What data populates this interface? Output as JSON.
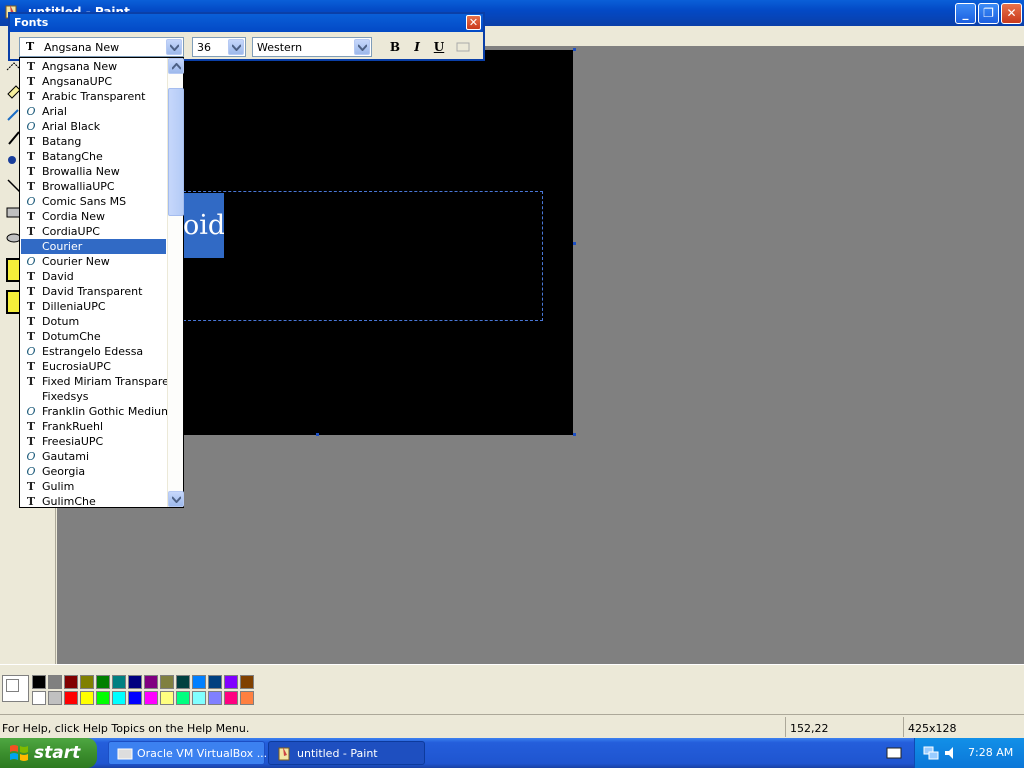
{
  "window": {
    "title": "untitled - Paint"
  },
  "fonts_toolbar": {
    "title": "Fonts",
    "font_name": "Angsana New",
    "font_size": "36",
    "script": "Western",
    "bold_label": "B",
    "italic_label": "I",
    "underline_label": "U"
  },
  "font_list": {
    "items": [
      {
        "name": "Angsana New",
        "icon": "truetype-icon"
      },
      {
        "name": "AngsanaUPC",
        "icon": "truetype-icon"
      },
      {
        "name": "Arabic Transparent",
        "icon": "truetype-icon"
      },
      {
        "name": "Arial",
        "icon": "opentype-icon"
      },
      {
        "name": "Arial Black",
        "icon": "opentype-icon"
      },
      {
        "name": "Batang",
        "icon": "truetype-icon"
      },
      {
        "name": "BatangChe",
        "icon": "truetype-icon"
      },
      {
        "name": "Browallia New",
        "icon": "truetype-icon"
      },
      {
        "name": "BrowalliaUPC",
        "icon": "truetype-icon"
      },
      {
        "name": "Comic Sans MS",
        "icon": "opentype-icon"
      },
      {
        "name": "Cordia New",
        "icon": "truetype-icon"
      },
      {
        "name": "CordiaUPC",
        "icon": "truetype-icon"
      },
      {
        "name": "Courier",
        "icon": "none"
      },
      {
        "name": "Courier New",
        "icon": "opentype-icon"
      },
      {
        "name": "David",
        "icon": "truetype-icon"
      },
      {
        "name": "David Transparent",
        "icon": "truetype-icon"
      },
      {
        "name": "DilleniaUPC",
        "icon": "truetype-icon"
      },
      {
        "name": "Dotum",
        "icon": "truetype-icon"
      },
      {
        "name": "DotumChe",
        "icon": "truetype-icon"
      },
      {
        "name": "Estrangelo Edessa",
        "icon": "opentype-icon"
      },
      {
        "name": "EucrosiaUPC",
        "icon": "truetype-icon"
      },
      {
        "name": "Fixed Miriam Transparent",
        "icon": "truetype-icon"
      },
      {
        "name": "Fixedsys",
        "icon": "none"
      },
      {
        "name": "Franklin Gothic Medium",
        "icon": "opentype-icon"
      },
      {
        "name": "FrankRuehl",
        "icon": "truetype-icon"
      },
      {
        "name": "FreesiaUPC",
        "icon": "truetype-icon"
      },
      {
        "name": "Gautami",
        "icon": "opentype-icon"
      },
      {
        "name": "Georgia",
        "icon": "opentype-icon"
      },
      {
        "name": "Gulim",
        "icon": "truetype-icon"
      },
      {
        "name": "GulimChe",
        "icon": "truetype-icon"
      }
    ],
    "selected": "Courier",
    "scroll_fraction": 0.05
  },
  "canvas": {
    "text_visible": "oid"
  },
  "palette": {
    "colors": [
      "#000000",
      "#808080",
      "#800000",
      "#808000",
      "#008000",
      "#008080",
      "#000080",
      "#800080",
      "#808040",
      "#004040",
      "#0080ff",
      "#004080",
      "#8000ff",
      "#804000",
      "#ffffff",
      "#c0c0c0",
      "#ff0000",
      "#ffff00",
      "#00ff00",
      "#00ffff",
      "#0000ff",
      "#ff00ff",
      "#ffff80",
      "#00ff80",
      "#80ffff",
      "#8080ff",
      "#ff0080",
      "#ff8040"
    ]
  },
  "statusbar": {
    "help": "For Help, click Help Topics on the Help Menu.",
    "coords": "152,22",
    "size": "425x128"
  },
  "taskbar": {
    "start_label": "start",
    "tasks": [
      {
        "label": "Oracle VM VirtualBox ..."
      },
      {
        "label": "untitled - Paint"
      }
    ],
    "clock": "7:28 AM"
  },
  "colors": {
    "title_blue": "#0349c5",
    "selection_blue": "#316ac5",
    "workspace_gray": "#808080"
  }
}
